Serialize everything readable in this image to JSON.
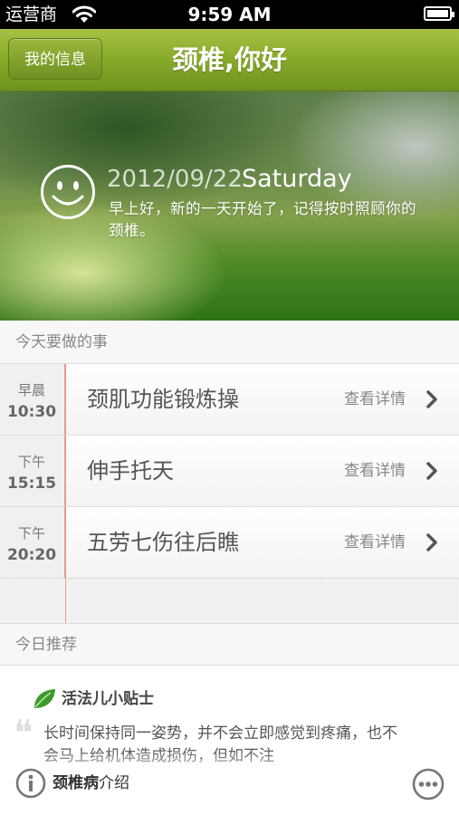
{
  "status_bar": {
    "carrier": "运营商",
    "time": "9:59 AM"
  },
  "nav": {
    "left_button": "我的信息",
    "title": "颈椎,你好"
  },
  "hero": {
    "date": "2012/09/22",
    "weekday": "Saturday",
    "message": "早上好，新的一天开始了，记得按时照顾你的颈椎。"
  },
  "today": {
    "header": "今天要做的事",
    "tasks": [
      {
        "period": "早晨",
        "time": "10:30",
        "title": "颈肌功能锻炼操",
        "detail": "查看详情"
      },
      {
        "period": "下午",
        "time": "15:15",
        "title": "伸手托天",
        "detail": "查看详情"
      },
      {
        "period": "下午",
        "time": "20:20",
        "title": "五劳七伤往后瞧",
        "detail": "查看详情"
      }
    ]
  },
  "recommend": {
    "header": "今日推荐",
    "title": "活法儿小贴士",
    "quote_mark": "❝",
    "body": "长时间保持同一姿势，并不会立即感觉到疼痛，也不会马上给机体造成损伤，但如不注",
    "info_bold": "颈椎病",
    "info_rest": "介绍"
  },
  "colors": {
    "nav_green": "#8aab2a",
    "timeline": "#e59b86",
    "leaf": "#3c9a2a"
  }
}
